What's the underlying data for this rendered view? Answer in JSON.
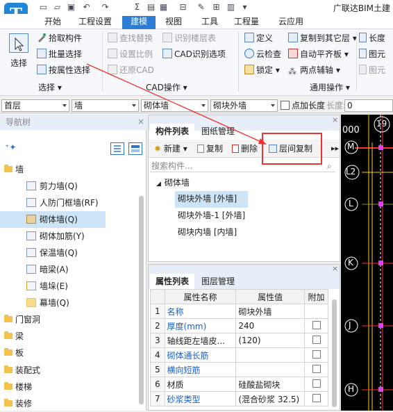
{
  "app": {
    "logo_letter": "T",
    "title": "广联达BIM土建"
  },
  "quick_access": [
    {
      "icon": "new-file-icon",
      "glyph": "▭"
    },
    {
      "icon": "open-folder-icon",
      "glyph": "▱"
    },
    {
      "icon": "save-icon",
      "glyph": "▣"
    },
    {
      "icon": "undo-icon",
      "glyph": "↶"
    },
    {
      "icon": "redo-icon",
      "glyph": "↷"
    },
    {
      "icon": "sum-icon",
      "glyph": "Σ"
    },
    {
      "icon": "report-icon",
      "glyph": "▤"
    },
    {
      "icon": "check-icon",
      "glyph": "▦"
    },
    {
      "icon": "ruler-icon",
      "glyph": "⊟"
    },
    {
      "icon": "pencil-icon",
      "glyph": "✎"
    },
    {
      "icon": "grid-icon",
      "glyph": "⊞"
    },
    {
      "icon": "layers-icon",
      "glyph": "▥"
    },
    {
      "icon": "dropdown-icon",
      "glyph": "▾"
    }
  ],
  "tabs": [
    "开始",
    "工程设置",
    "建模",
    "视图",
    "工具",
    "工程量",
    "云应用"
  ],
  "active_tab": "建模",
  "ribbon": {
    "select_big": "选择",
    "pick_component": "拾取构件",
    "batch_select": "批量选择",
    "select_by_attr": "按属性选择",
    "find_replace": "查找替换",
    "set_ratio": "设置比例",
    "restore_cad": "还原CAD",
    "identify_floor_table": "识别楼层表",
    "cad_identify_options": "CAD识别选项",
    "define": "定义",
    "cloud_check": "云检查",
    "lock": "锁定",
    "copy_to_other_floor": "复制到其它层",
    "auto_flat_slab": "自动平齐板",
    "two_point_aux": "两点辅轴",
    "length": "长度",
    "element_display": "图元",
    "element_other": "图元",
    "group_select": "选择",
    "group_cad": "CAD操作",
    "group_general": "通用操作"
  },
  "selectors": {
    "floor": "首层",
    "category": "墙",
    "type": "砌体墙",
    "component": "砌块外墙",
    "point_length_label": "点加长度",
    "length_label": "长度:",
    "length_value": "0"
  },
  "nav": {
    "title": "导航树",
    "items": [
      {
        "label": "墙",
        "level": 0,
        "icon": "folder-icon"
      },
      {
        "label": "剪力墙(Q)",
        "level": 1,
        "icon": "shear-wall-icon"
      },
      {
        "label": "人防门框墙(RF)",
        "level": 1,
        "icon": "civil-defense-wall-icon"
      },
      {
        "label": "砌体墙(Q)",
        "level": 1,
        "icon": "masonry-wall-icon",
        "selected": true
      },
      {
        "label": "砌体加筋(Y)",
        "level": 1,
        "icon": "masonry-rebar-icon"
      },
      {
        "label": "保温墙(Q)",
        "level": 1,
        "icon": "insulation-wall-icon"
      },
      {
        "label": "暗梁(A)",
        "level": 1,
        "icon": "hidden-beam-icon"
      },
      {
        "label": "墙垛(E)",
        "level": 1,
        "icon": "wall-pier-icon"
      },
      {
        "label": "幕墙(Q)",
        "level": 1,
        "icon": "curtain-wall-icon"
      },
      {
        "label": "门窗洞",
        "level": 0,
        "icon": "folder-icon"
      },
      {
        "label": "梁",
        "level": 0,
        "icon": "folder-icon"
      },
      {
        "label": "板",
        "level": 0,
        "icon": "folder-icon"
      },
      {
        "label": "装配式",
        "level": 0,
        "icon": "folder-icon"
      },
      {
        "label": "楼梯",
        "level": 0,
        "icon": "folder-icon"
      },
      {
        "label": "装修",
        "level": 0,
        "icon": "folder-icon"
      }
    ]
  },
  "component_panel": {
    "tab_active": "构件列表",
    "tab_other": "图纸管理",
    "new_label": "新建",
    "copy_label": "复制",
    "delete_label": "删除",
    "floor_copy_label": "层间复制",
    "search_placeholder": "搜索构件...",
    "group": "砌体墙",
    "items": [
      {
        "label": "砌块外墙 [外墙]",
        "selected": true
      },
      {
        "label": "砌块外墙-1 [外墙]",
        "selected": false
      },
      {
        "label": "砌块内墙 [内墙]",
        "selected": false
      }
    ]
  },
  "property_panel": {
    "tab_active": "属性列表",
    "tab_other": "图层管理",
    "headers": [
      "",
      "属性名称",
      "属性值",
      "附加"
    ],
    "rows": [
      {
        "no": "1",
        "name": "名称",
        "value": "砌块外墙",
        "blue": true,
        "check": false
      },
      {
        "no": "2",
        "name": "厚度(mm)",
        "value": "240",
        "blue": true,
        "check": true
      },
      {
        "no": "3",
        "name": "轴线距左墙皮...",
        "value": "(120)",
        "blue": false,
        "check": true
      },
      {
        "no": "4",
        "name": "砌体通长筋",
        "value": "",
        "blue": true,
        "check": true
      },
      {
        "no": "5",
        "name": "横向短筋",
        "value": "",
        "blue": true,
        "check": true
      },
      {
        "no": "6",
        "name": "材质",
        "value": "硅酸盐砌块",
        "blue": false,
        "check": true
      },
      {
        "no": "7",
        "name": "砂浆类型",
        "value": "(混合砂浆  32.5)",
        "blue": true,
        "check": true
      }
    ]
  },
  "drawing": {
    "dimension": "000",
    "axes": [
      "19",
      "M",
      "L2",
      "L",
      "K",
      "J",
      "H"
    ]
  },
  "colors": {
    "accent": "#2e7cd1",
    "annotation": "#e33333",
    "selected_row": "#cde4f7"
  }
}
